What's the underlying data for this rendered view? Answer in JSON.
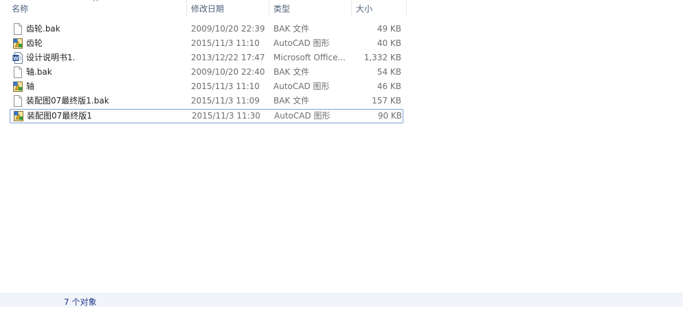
{
  "columns": {
    "name": "名称",
    "date_modified": "修改日期",
    "type": "类型",
    "size": "大小"
  },
  "files": [
    {
      "name": "齿轮.bak",
      "date": "2009/10/20 22:39",
      "type": "BAK 文件",
      "size": "49 KB",
      "icon": "blank-file-icon"
    },
    {
      "name": "齿轮",
      "date": "2015/11/3 11:10",
      "type": "AutoCAD 图形",
      "size": "40 KB",
      "icon": "autocad-drawing-icon"
    },
    {
      "name": "设计说明书1.",
      "date": "2013/12/22 17:47",
      "type": "Microsoft Office...",
      "size": "1,332 KB",
      "icon": "word-document-icon"
    },
    {
      "name": "轴.bak",
      "date": "2009/10/20 22:40",
      "type": "BAK 文件",
      "size": "54 KB",
      "icon": "blank-file-icon"
    },
    {
      "name": "轴",
      "date": "2015/11/3 11:10",
      "type": "AutoCAD 图形",
      "size": "46 KB",
      "icon": "autocad-drawing-icon"
    },
    {
      "name": "装配图07最终版1.bak",
      "date": "2015/11/3 11:09",
      "type": "BAK 文件",
      "size": "157 KB",
      "icon": "blank-file-icon"
    },
    {
      "name": "装配图07最终版1",
      "date": "2015/11/3 11:30",
      "type": "AutoCAD 图形",
      "size": "90 KB",
      "icon": "autocad-drawing-icon",
      "selected": true
    }
  ],
  "status": {
    "item_count": "7 个对象"
  },
  "colors": {
    "header_text": "#4c607a",
    "selection_border": "#7da2ce",
    "status_text": "#1e3287",
    "status_bg": "#f1f5fb"
  }
}
